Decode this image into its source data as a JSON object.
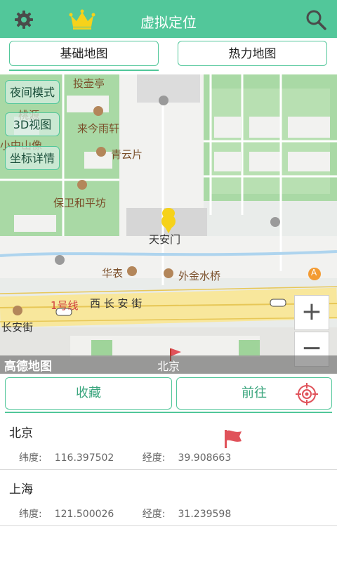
{
  "header": {
    "title": "虚拟定位",
    "settings_icon": "gear-icon",
    "vip_icon": "crown-icon",
    "search_icon": "search-icon",
    "bg_color": "#52c79a"
  },
  "tabs": [
    {
      "label": "基础地图",
      "selected": true
    },
    {
      "label": "热力地图",
      "selected": false
    }
  ],
  "map": {
    "buttons": [
      "夜间模式",
      "3D视图",
      "坐标详情"
    ],
    "marker_label": "天安门",
    "zoom_in": "+",
    "zoom_out": "−",
    "logo": "高德地图",
    "city_label": "北京",
    "labels": {
      "a": "投壶亭",
      "b": "桃源",
      "c": "来今雨轩",
      "d": "小中山像",
      "e": "青云片",
      "f": "保卫和平坊",
      "g": "华表",
      "h": "外金水桥",
      "i": "1号线",
      "j": "西 长 安 街",
      "k": "长安街",
      "l": "A"
    }
  },
  "actions": {
    "favorite": "收藏",
    "go": "前往",
    "target_icon": "crosshair-icon"
  },
  "favorites": [
    {
      "name": "北京",
      "lat_label": "纬度:",
      "lat": "116.397502",
      "lng_label": "经度:",
      "lng": "39.908663",
      "icon": "flag-icon"
    },
    {
      "name": "上海",
      "lat_label": "纬度:",
      "lat": "121.500026",
      "lng_label": "经度:",
      "lng": "31.239598"
    }
  ],
  "colors": {
    "accent": "#52c79a",
    "flag": "#e0525a",
    "target": "#e0525a",
    "road": "#f4d86a"
  }
}
